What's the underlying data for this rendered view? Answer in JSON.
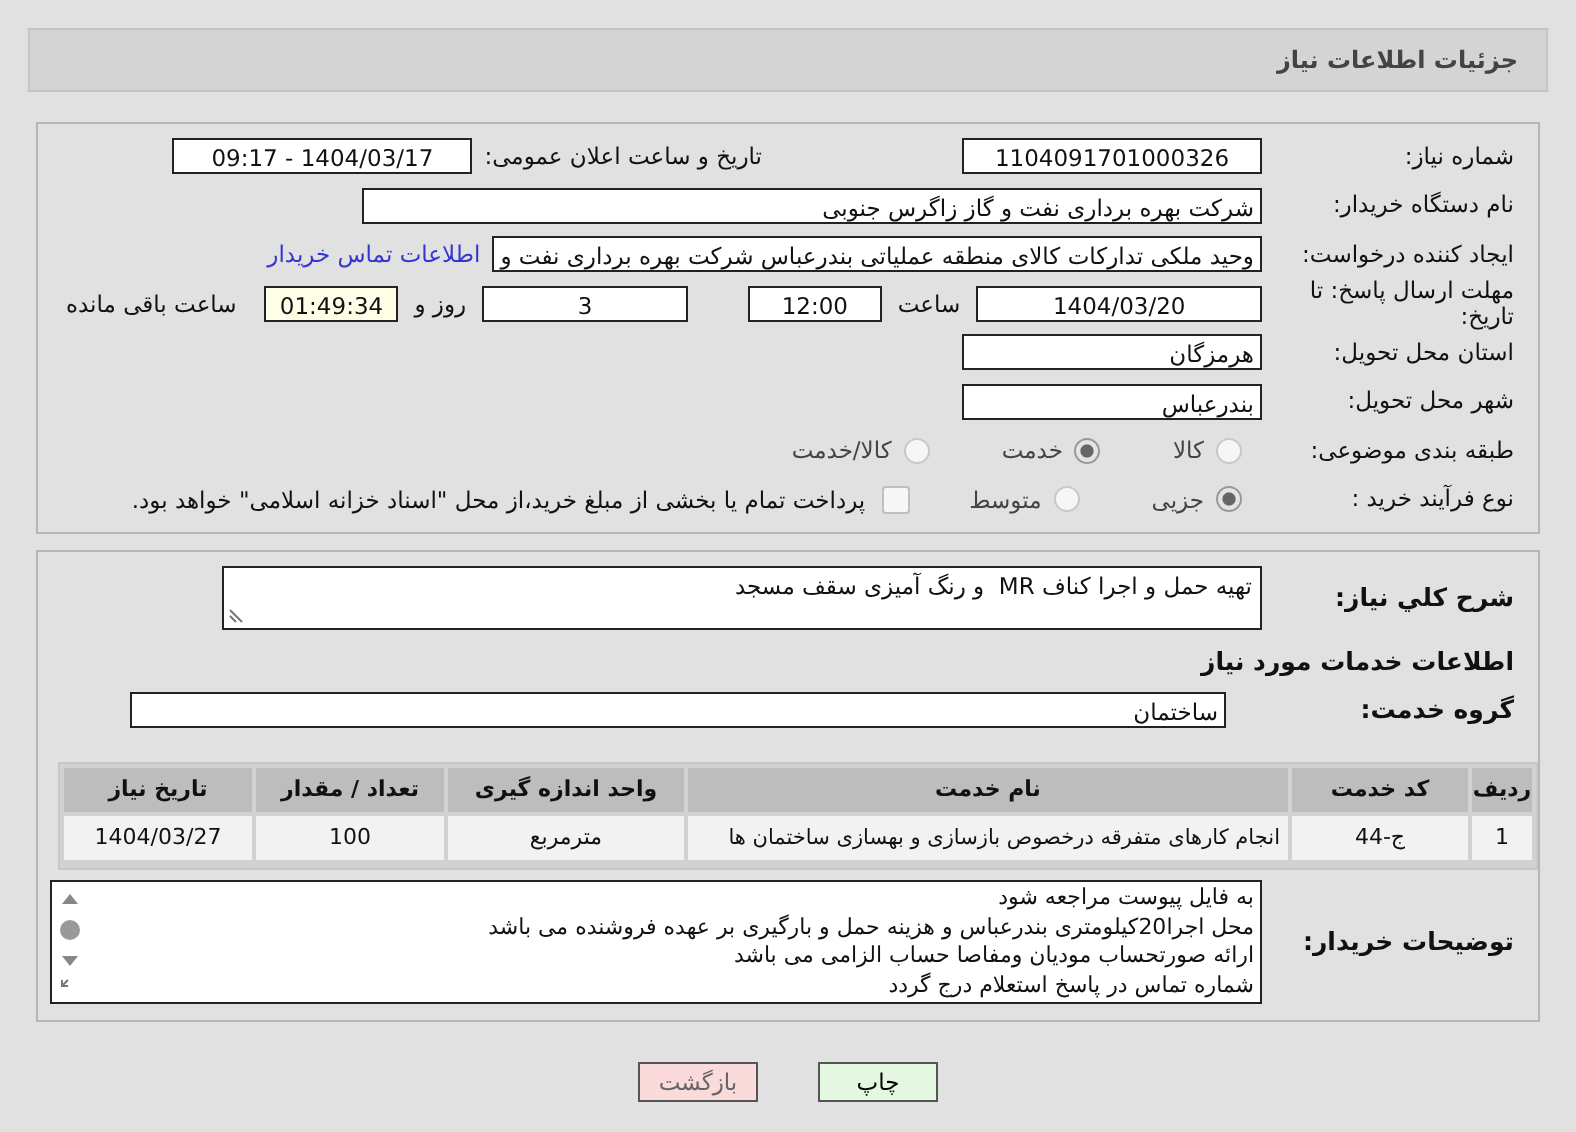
{
  "header": {
    "title": "جزئیات اطلاعات نیاز"
  },
  "need_number": {
    "label": "شماره نیاز:",
    "value": "1104091701000326"
  },
  "announce": {
    "label": "تاریخ و ساعت اعلان عمومی:",
    "value": "1404/03/17 - 09:17"
  },
  "buyer_org": {
    "label": "نام دستگاه خریدار:",
    "value": "شرکت بهره برداری نفت و گاز زاگرس جنوبی"
  },
  "requester": {
    "label": "ایجاد کننده درخواست:",
    "value": "وحید ملکی تدارکات کالای منطقه عملیاتی بندرعباس شرکت بهره برداری نفت و",
    "contact_link": "اطلاعات تماس خریدار"
  },
  "deadline": {
    "label": "مهلت ارسال پاسخ: تا تاریخ:",
    "date": "1404/03/20",
    "time_label": "ساعت",
    "time": "12:00",
    "days": "3",
    "days_label": "روز و",
    "remaining": "01:49:34",
    "remaining_label": "ساعت باقی مانده"
  },
  "province": {
    "label": "استان محل تحویل:",
    "value": "هرمزگان"
  },
  "city": {
    "label": "شهر محل تحویل:",
    "value": "بندرعباس"
  },
  "category": {
    "label": "طبقه بندی موضوعی:",
    "options": [
      {
        "label": "کالا",
        "selected": false
      },
      {
        "label": "خدمت",
        "selected": true
      },
      {
        "label": "کالا/خدمت",
        "selected": false
      }
    ]
  },
  "purchase_type": {
    "label": "نوع فرآیند خرید :",
    "options": [
      {
        "label": "جزیی",
        "selected": true
      },
      {
        "label": "متوسط",
        "selected": false
      }
    ],
    "payment": {
      "checked": false,
      "text": "پرداخت تمام یا بخشی از مبلغ خرید،از محل \"اسناد خزانه اسلامی\" خواهد بود."
    }
  },
  "description": {
    "label": "شرح کلي نیاز:",
    "value": "تهیه حمل و اجرا کناف MR  و رنگ آمیزی سقف مسجد"
  },
  "services_heading": "اطلاعات خدمات مورد نیاز",
  "service_group": {
    "label": "گروه خدمت:",
    "value": "ساختمان"
  },
  "table": {
    "columns": [
      "ردیف",
      "کد خدمت",
      "نام خدمت",
      "واحد اندازه گیری",
      "تعداد / مقدار",
      "تاریخ نیاز"
    ],
    "rows": [
      [
        "1",
        "ج-44",
        "انجام کارهای متفرقه درخصوص بازسازی و بهسازی ساختمان ها",
        "مترمربع",
        "100",
        "1404/03/27"
      ]
    ]
  },
  "buyer_notes": {
    "label": "توضیحات خریدار:",
    "lines": [
      "به فایل پیوست مراجعه شود",
      "محل اجرا20کیلومتری بندرعباس و هزینه حمل و بارگیری بر عهده فروشنده می باشد",
      "ارائه صورتحساب مودیان ومفاصا حساب الزامی می باشد",
      "شماره تماس در پاسخ استعلام درج گردد"
    ]
  },
  "buttons": [
    {
      "label": "چاپ",
      "kind": "print"
    },
    {
      "label": "بازگشت",
      "kind": "back"
    }
  ]
}
